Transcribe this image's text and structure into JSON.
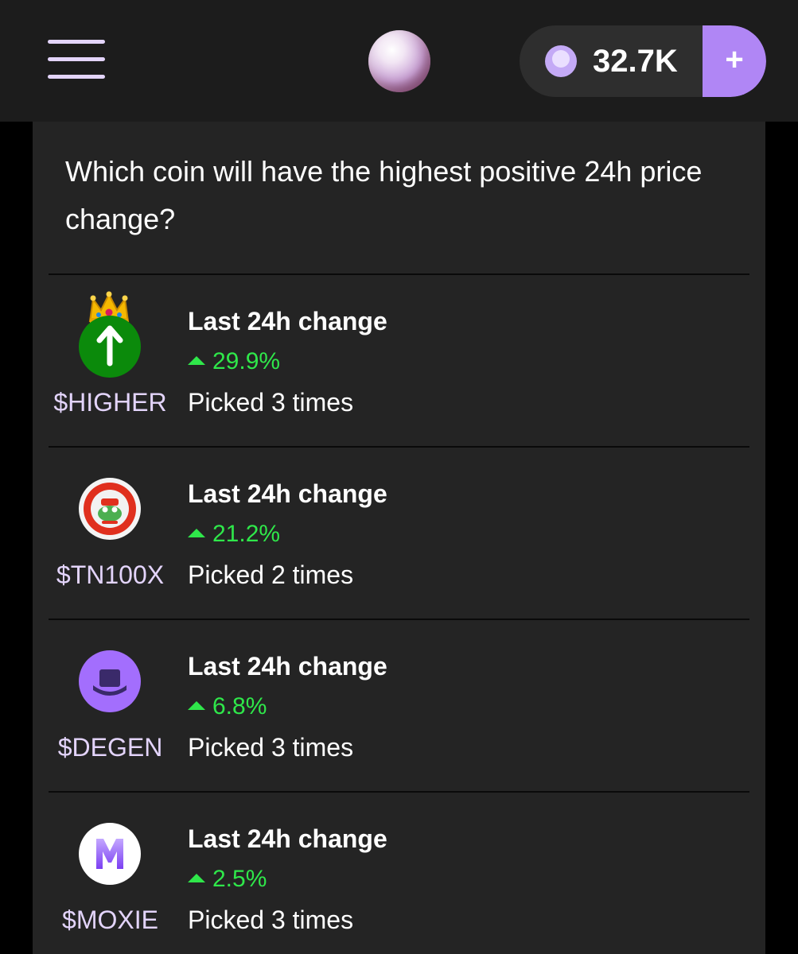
{
  "header": {
    "balance": "32.7K",
    "add_label": "+"
  },
  "question": "Which coin will have the highest positive 24h price change?",
  "coins": [
    {
      "ticker": "$HIGHER",
      "change_title": "Last 24h change",
      "change": "29.9%",
      "picked": "Picked 3 times",
      "icon": "higher-up-arrow-icon",
      "leader": true
    },
    {
      "ticker": "$TN100X",
      "change_title": "Last 24h change",
      "change": "21.2%",
      "picked": "Picked 2 times",
      "icon": "tn100x-pepe-icon"
    },
    {
      "ticker": "$DEGEN",
      "change_title": "Last 24h change",
      "change": "6.8%",
      "picked": "Picked 3 times",
      "icon": "degen-top-hat-icon"
    },
    {
      "ticker": "$MOXIE",
      "change_title": "Last 24h change",
      "change": "2.5%",
      "picked": "Picked 3 times",
      "icon": "moxie-m-icon"
    }
  ],
  "colors": {
    "accent": "#b086f5",
    "positive": "#2fe74a",
    "ticker": "#e3d4fb",
    "background": "#242424"
  }
}
